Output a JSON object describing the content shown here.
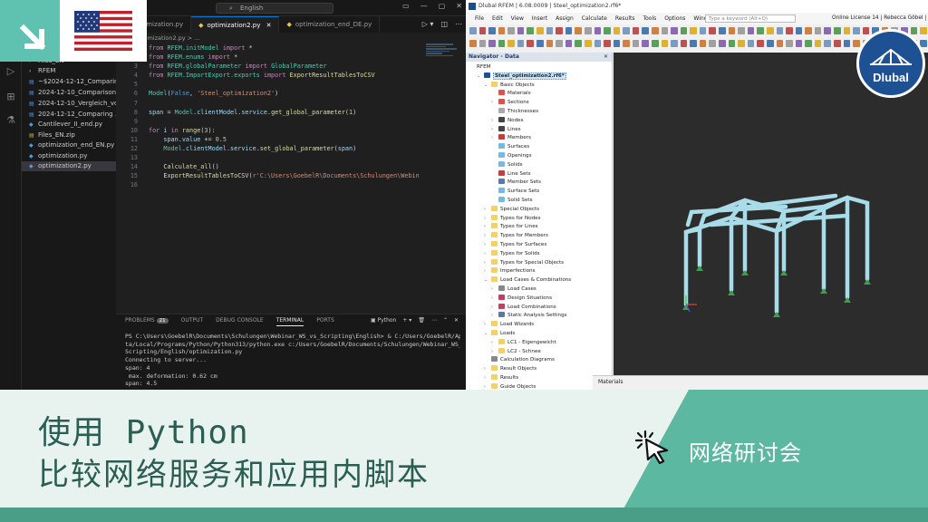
{
  "vscode": {
    "search_text": "English",
    "tabs": [
      {
        "label": "...ptimization.py"
      },
      {
        "label": "optimization2.py"
      },
      {
        "label": "optimization_end_DE.py"
      }
    ],
    "breadcrumb": "ptimization2.py > ...",
    "files": [
      {
        "label": "Files_EN"
      },
      {
        "label": "RFEM"
      },
      {
        "label": "~$2024-12-12_Comparin..."
      },
      {
        "label": "2024-12-10_Comparison..."
      },
      {
        "label": "2024-12-10_Vergleich_vo..."
      },
      {
        "label": "2024-12-12_Comparing ..."
      },
      {
        "label": "Cantilever_II_end.py"
      },
      {
        "label": "Files_EN.zip"
      },
      {
        "label": "optimization_end_EN.py"
      },
      {
        "label": "optimization.py"
      },
      {
        "label": "optimization2.py"
      }
    ],
    "code": [
      {
        "n": "1",
        "t": "from RFEM.initModel import *"
      },
      {
        "n": "2",
        "t": "from RFEM.enums import *"
      },
      {
        "n": "3",
        "t": "from RFEM.globalParameter import GlobalParameter"
      },
      {
        "n": "4",
        "t": "from RFEM.ImportExport.exports import ExportResultTablesToCSV"
      },
      {
        "n": "5",
        "t": ""
      },
      {
        "n": "6",
        "t": "Model(False, 'Steel_optimization2')"
      },
      {
        "n": "7",
        "t": ""
      },
      {
        "n": "8",
        "t": "span = Model.clientModel.service.get_global_parameter(1)"
      },
      {
        "n": "9",
        "t": ""
      },
      {
        "n": "10",
        "t": "for i in range(3):"
      },
      {
        "n": "11",
        "t": "    span.value += 0.5"
      },
      {
        "n": "12",
        "t": "    Model.clientModel.service.set_global_parameter(span)"
      },
      {
        "n": "13",
        "t": ""
      },
      {
        "n": "14",
        "t": "    Calculate_all()"
      },
      {
        "n": "15",
        "t": "    ExportResultTablesToCSV(r'C:\\Users\\GoebelR\\Documents\\Schulungen\\Webin"
      },
      {
        "n": "16",
        "t": ""
      }
    ],
    "panel_tabs": [
      "PROBLEMS",
      "OUTPUT",
      "DEBUG CONSOLE",
      "TERMINAL",
      "PORTS"
    ],
    "problems_count": "21",
    "terminal_shell": "Python",
    "terminal": [
      "PS C:\\Users\\GoebelR\\Documents\\Schulungen\\Webinar_WS_vs_Scripting\\English> & C:/Users/GoebelR/AppDa",
      "ta/Local/Programs/Python/Python313/python.exe c:/Users/GoebelR/Documents/Schulungen/Webinar_WS_vs_",
      "Scripting/English/optimization.py",
      "Connecting to server...",
      "span: 4",
      " max. deformation: 0.62 cm",
      "span: 4.5"
    ]
  },
  "rfem": {
    "title": "Dlubal RFEM | 6.08.0009 | Steel_optimization2.rf6*",
    "menu": [
      "File",
      "Edit",
      "View",
      "Insert",
      "Assign",
      "Calculate",
      "Results",
      "Tools",
      "Options",
      "Window"
    ],
    "keyword_placeholder": "Type a keyword (Alt+Q)",
    "license": "Online License 14 | Rebecca Göbel | Dluba",
    "navigator_title": "Navigator - Data",
    "navigator": [
      {
        "label": "RFEM",
        "lvl": 0,
        "ex": "",
        "color": ""
      },
      {
        "label": "Steel_optimization2.rf6*",
        "lvl": 1,
        "ex": "v",
        "color": "#1e5194",
        "sel": true
      },
      {
        "label": "Basic Objects",
        "lvl": 2,
        "ex": "v",
        "color": "#f2d06b"
      },
      {
        "label": "Materials",
        "lvl": 3,
        "ex": "",
        "color": "#d9534f"
      },
      {
        "label": "Sections",
        "lvl": 3,
        "ex": ">",
        "color": "#d9534f"
      },
      {
        "label": "Thicknesses",
        "lvl": 3,
        "ex": "",
        "color": "#aaaaaa"
      },
      {
        "label": "Nodes",
        "lvl": 3,
        "ex": ">",
        "color": "#444444"
      },
      {
        "label": "Lines",
        "lvl": 3,
        "ex": ">",
        "color": "#444444"
      },
      {
        "label": "Members",
        "lvl": 3,
        "ex": ">",
        "color": "#c04040"
      },
      {
        "label": "Surfaces",
        "lvl": 3,
        "ex": "",
        "color": "#7ab8e0"
      },
      {
        "label": "Openings",
        "lvl": 3,
        "ex": "",
        "color": "#7ab8e0"
      },
      {
        "label": "Solids",
        "lvl": 3,
        "ex": "",
        "color": "#7ab8e0"
      },
      {
        "label": "Line Sets",
        "lvl": 3,
        "ex": "",
        "color": "#c04040"
      },
      {
        "label": "Member Sets",
        "lvl": 3,
        "ex": "",
        "color": "#5a7aa0"
      },
      {
        "label": "Surface Sets",
        "lvl": 3,
        "ex": "",
        "color": "#7ab8e0"
      },
      {
        "label": "Solid Sets",
        "lvl": 3,
        "ex": "",
        "color": "#7ab8e0"
      },
      {
        "label": "Special Objects",
        "lvl": 2,
        "ex": ">",
        "color": "#f2d06b"
      },
      {
        "label": "Types for Nodes",
        "lvl": 2,
        "ex": ">",
        "color": "#f2d06b"
      },
      {
        "label": "Types for Lines",
        "lvl": 2,
        "ex": ">",
        "color": "#f2d06b"
      },
      {
        "label": "Types for Members",
        "lvl": 2,
        "ex": ">",
        "color": "#f2d06b"
      },
      {
        "label": "Types for Surfaces",
        "lvl": 2,
        "ex": ">",
        "color": "#f2d06b"
      },
      {
        "label": "Types for Solids",
        "lvl": 2,
        "ex": ">",
        "color": "#f2d06b"
      },
      {
        "label": "Types for Special Objects",
        "lvl": 2,
        "ex": ">",
        "color": "#f2d06b"
      },
      {
        "label": "Imperfections",
        "lvl": 2,
        "ex": ">",
        "color": "#f2d06b"
      },
      {
        "label": "Load Cases & Combinations",
        "lvl": 2,
        "ex": "v",
        "color": "#f2d06b"
      },
      {
        "label": "Load Cases",
        "lvl": 3,
        "ex": ">",
        "color": "#888888"
      },
      {
        "label": "Design Situations",
        "lvl": 3,
        "ex": ">",
        "color": "#c04060"
      },
      {
        "label": "Load Combinations",
        "lvl": 3,
        "ex": ">",
        "color": "#c04060"
      },
      {
        "label": "Static Analysis Settings",
        "lvl": 3,
        "ex": ">",
        "color": "#5a7aa0"
      },
      {
        "label": "Load Wizards",
        "lvl": 2,
        "ex": ">",
        "color": "#f2d06b"
      },
      {
        "label": "Loads",
        "lvl": 2,
        "ex": "v",
        "color": "#f2d06b"
      },
      {
        "label": "LC1 - Eigengewicht",
        "lvl": 3,
        "ex": ">",
        "color": "#f2d06b"
      },
      {
        "label": "LC2 - Schnee",
        "lvl": 3,
        "ex": ">",
        "color": "#f2d06b"
      },
      {
        "label": "Calculation Diagrams",
        "lvl": 2,
        "ex": "",
        "color": "#888888"
      },
      {
        "label": "Result Objects",
        "lvl": 2,
        "ex": ">",
        "color": "#f2d06b"
      },
      {
        "label": "Results",
        "lvl": 2,
        "ex": ">",
        "color": "#f2d06b"
      },
      {
        "label": "Guide Objects",
        "lvl": 2,
        "ex": ">",
        "color": "#f2d06b"
      }
    ],
    "bottom_panel_label": "Materials",
    "lc_label": "LC1"
  },
  "overlay": {
    "brand": "Dlubal",
    "title_line1": "使用 Python",
    "title_line2": "比较网络服务和应用内脚本",
    "webinar_label": "网络研讨会",
    "colors": {
      "accent": "#5cb8a0",
      "banner_bg": "#e8f3ef",
      "text_dark": "#2b5e52",
      "brand_blue": "#1e5194"
    }
  }
}
